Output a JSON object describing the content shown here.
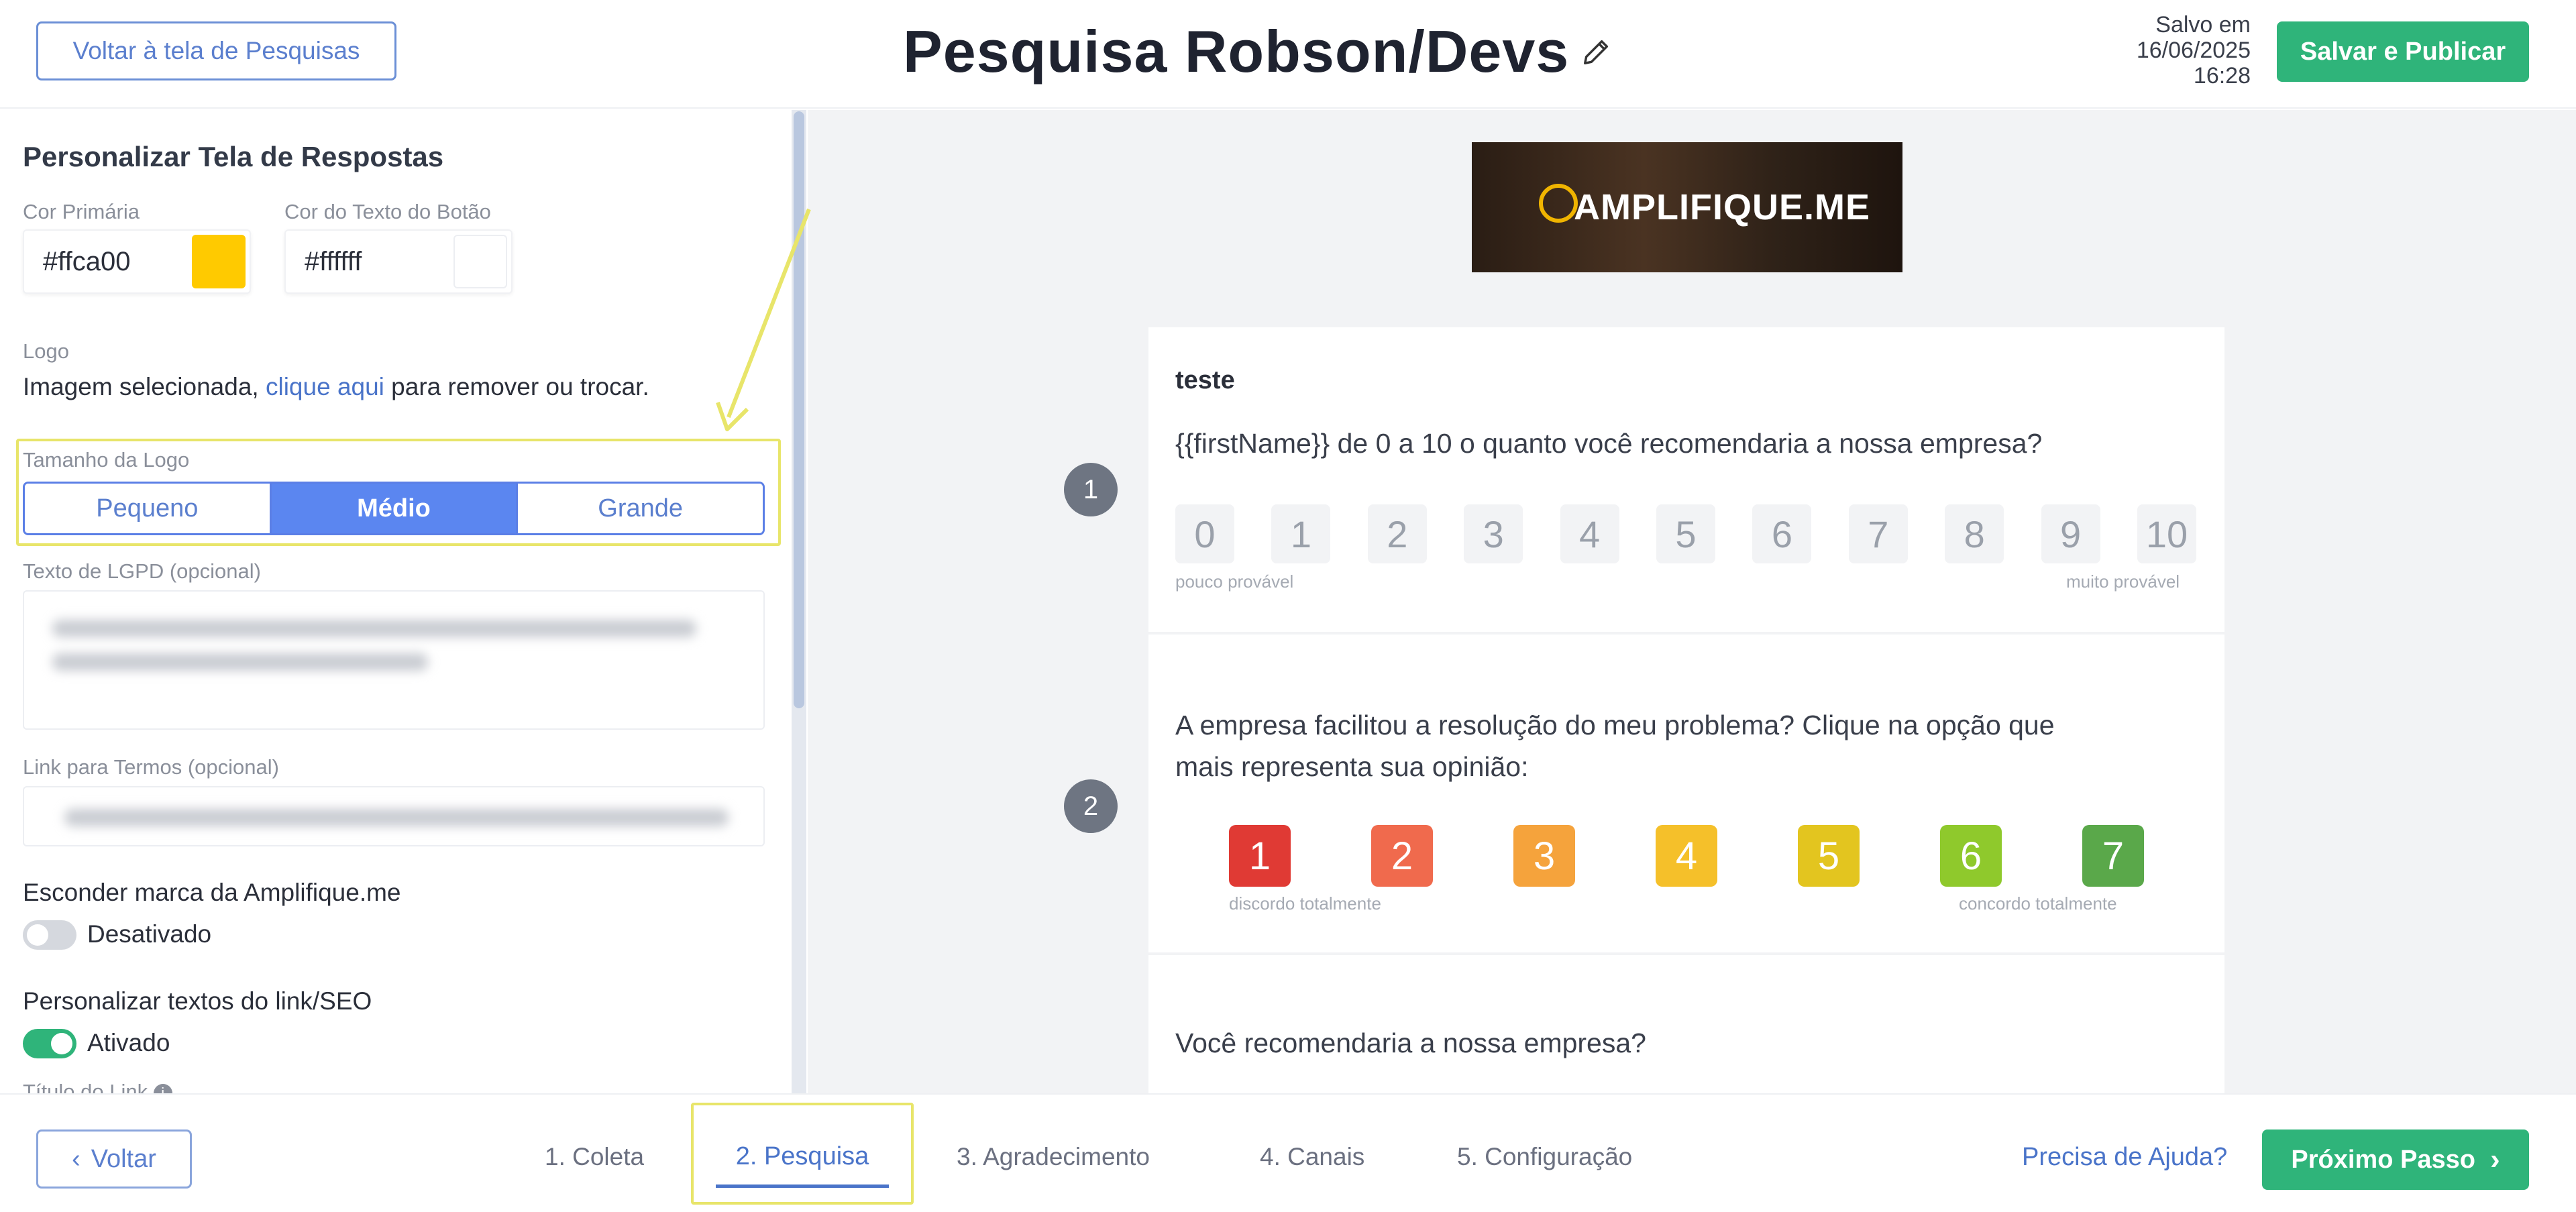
{
  "header": {
    "back_label": "Voltar à tela de Pesquisas",
    "title": "Pesquisa Robson/Devs",
    "saved_line1": "Salvo em",
    "saved_date": "16/06/2025",
    "saved_time": "16:28",
    "publish_label": "Salvar e Publicar"
  },
  "panel": {
    "title": "Personalizar Tela de Respostas",
    "primary_color_label": "Cor Primária",
    "primary_color_value": "#ffca00",
    "button_text_color_label": "Cor do Texto do Botão",
    "button_text_color_value": "#ffffff",
    "logo_label": "Logo",
    "logo_text_before": "Imagem selecionada, ",
    "logo_link": "clique aqui",
    "logo_text_after": " para remover ou trocar.",
    "logo_size_label": "Tamanho da Logo",
    "logo_sizes": [
      "Pequeno",
      "Médio",
      "Grande"
    ],
    "logo_size_selected": "Médio",
    "lgpd_label": "Texto de LGPD (opcional)",
    "terms_label": "Link para Termos (opcional)",
    "hide_brand_label": "Esconder marca da Amplifique.me",
    "hide_brand_state": "Desativado",
    "hide_brand_on": false,
    "seo_label": "Personalizar textos do link/SEO",
    "seo_state": "Ativado",
    "seo_on": true,
    "link_title_label": "Título do Link"
  },
  "preview": {
    "logo_text": "AMPLIFIQUE.ME",
    "q1": {
      "number": "1",
      "title": "teste",
      "text": "{{firstName}} de 0 a 10 o quanto você recomendaria a nossa empresa?",
      "options": [
        "0",
        "1",
        "2",
        "3",
        "4",
        "5",
        "6",
        "7",
        "8",
        "9",
        "10"
      ],
      "low_label": "pouco provável",
      "high_label": "muito provável"
    },
    "q2": {
      "number": "2",
      "text_line1": "A empresa facilitou a resolução do meu problema? Clique na opção que",
      "text_line2": "mais representa sua opinião:",
      "options": [
        "1",
        "2",
        "3",
        "4",
        "5",
        "6",
        "7"
      ],
      "option_colors": [
        "#e03a34",
        "#f06a4d",
        "#f5a33c",
        "#f5c02a",
        "#e3c51f",
        "#8fc92c",
        "#5aa84a"
      ],
      "low_label": "discordo totalmente",
      "high_label": "concordo totalmente"
    },
    "q3": {
      "text": "Você recomendaria a nossa empresa?"
    }
  },
  "footer": {
    "back_label": "Voltar",
    "steps": [
      "1. Coleta",
      "2. Pesquisa",
      "3. Agradecimento",
      "4. Canais",
      "5. Configuração"
    ],
    "active_step": "2. Pesquisa",
    "help_label": "Precisa de Ajuda?",
    "next_label": "Próximo Passo"
  },
  "colors": {
    "accent": "#5b86f0",
    "green": "#2fb47a",
    "highlight": "#e8e56a"
  }
}
